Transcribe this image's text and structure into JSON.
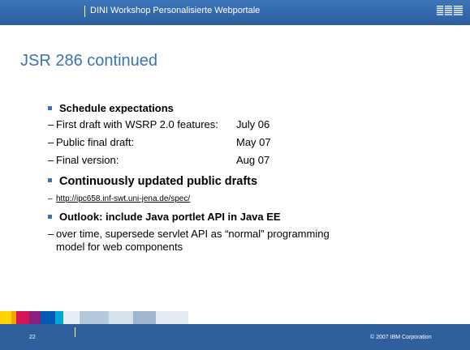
{
  "header": {
    "title": "DINI Workshop Personalisierte Webportale",
    "logo_text": "IBM"
  },
  "slide": {
    "title": "JSR 286 continued"
  },
  "content": {
    "schedule": {
      "heading": "Schedule expectations",
      "items": [
        {
          "label": "First draft with WSRP 2.0 features:",
          "value": "July 06"
        },
        {
          "label": "Public final draft:",
          "value": "May 07"
        },
        {
          "label": "Final version:",
          "value": "Aug 07"
        }
      ]
    },
    "drafts": {
      "heading": "Continuously updated public drafts",
      "link": "http://ipc658.inf-swt.uni-jena.de/spec/"
    },
    "outlook": {
      "heading": "Outlook: include Java portlet API in Java EE",
      "line1": "over time, supersede servlet API as “normal” programming",
      "line2": "model for web components"
    }
  },
  "footer": {
    "page_number": "22",
    "copyright": "© 2007 IBM Corporation"
  },
  "colors": {
    "header_blue": "#3c74b8",
    "title_blue": "#3a73b4",
    "footer_blue": "#2f5f9c"
  }
}
